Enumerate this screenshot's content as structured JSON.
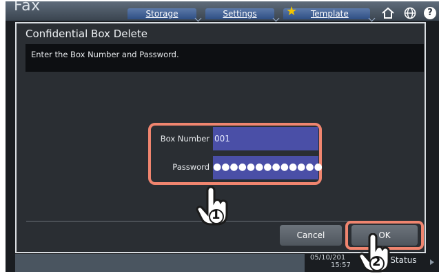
{
  "header": {
    "app_title": "Fax",
    "tabs": [
      {
        "label": "Storage"
      },
      {
        "label": "Settings"
      },
      {
        "label": "Template"
      }
    ],
    "icons": [
      "star-icon",
      "home-icon",
      "globe-icon",
      "help-icon"
    ],
    "help_label": "?"
  },
  "dialog": {
    "title": "Confidential Box Delete",
    "message": "Enter the Box Number and Password.",
    "box_number": {
      "label": "Box Number",
      "value": "001"
    },
    "password": {
      "label": "Password",
      "masked_value": "●●●●●●●●●●●●●"
    },
    "buttons": {
      "cancel": "Cancel",
      "ok": "OK"
    }
  },
  "footer": {
    "date": "05/10/201",
    "time": "15:57",
    "job_status_label": "Job Status"
  },
  "callouts": {
    "step1": "1",
    "step2": "2"
  },
  "colors": {
    "highlight": "#f0856f",
    "input_bg": "#4a4fa7",
    "dialog_bg": "#2a2e33"
  }
}
